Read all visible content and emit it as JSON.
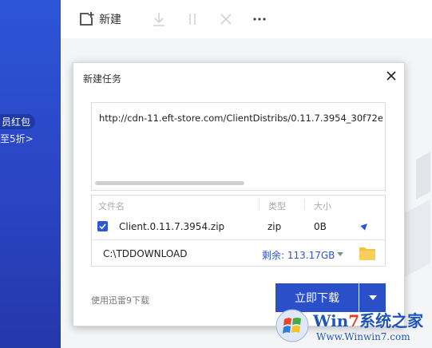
{
  "sidebar": {
    "promo_line1": "员红包",
    "promo_line2": "至5折>"
  },
  "toolbar": {
    "new_label": "新建",
    "icons": [
      "new-task-icon",
      "download-icon",
      "pause-icon",
      "delete-icon",
      "more-icon"
    ]
  },
  "dialog": {
    "title": "新建任务",
    "url": "http://cdn-11.eft-store.com/ClientDistribs/0.11.7.3954_30f72e",
    "headers": {
      "name": "文件名",
      "type": "类型",
      "size": "大小"
    },
    "file": {
      "name": "Client.0.11.7.3954.zip",
      "type": "zip",
      "size": "0B",
      "checked": true
    },
    "path": "C:\\TDDOWNLOAD",
    "remaining": "剩余: 113.17GB",
    "footnote": "使用迅雷9下载",
    "download_label": "立即下载"
  },
  "watermark": {
    "brand_a": "Win",
    "brand_b": "7",
    "brand_c": "系统之家",
    "url": "Www.Winwin7.com"
  },
  "colors": {
    "accent": "#2b4fc8",
    "sidebar": "#2a44c4",
    "folder": "#f5c244"
  }
}
